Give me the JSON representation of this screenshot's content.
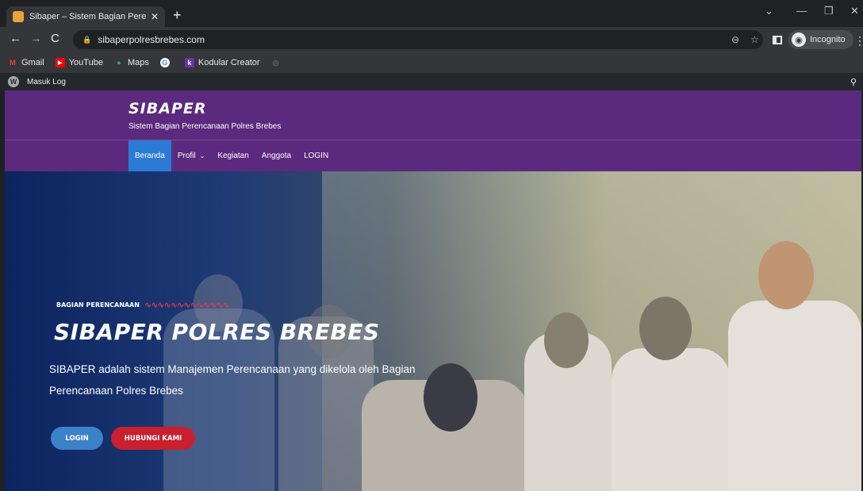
{
  "browser": {
    "tab_title": "Sibaper – Sistem Bagian Perencaa",
    "url": "sibaperpolresbrebes.com",
    "incognito_label": "Incognito",
    "bookmarks": [
      {
        "label": "Gmail",
        "icon": "gmail-icon",
        "color": "#ea4335"
      },
      {
        "label": "YouTube",
        "icon": "youtube-icon",
        "color": "#ff0000"
      },
      {
        "label": "Maps",
        "icon": "maps-icon",
        "color": "#34a853"
      },
      {
        "label": "",
        "icon": "google-icon",
        "color": "#ffffff"
      },
      {
        "label": "Kodular Creator",
        "icon": "kodular-icon",
        "color": "#6a32b0"
      }
    ]
  },
  "admin_bar": {
    "login_label": "Masuk Log"
  },
  "site": {
    "brand": "SIBAPER",
    "tagline": "Sistem Bagian Perencanaan Polres Brebes",
    "nav": [
      "Beranda",
      "Profil",
      "Kegiatan",
      "Anggota",
      "LOGIN"
    ],
    "accent": "#5b2a7e",
    "active_color": "#2b7bd5"
  },
  "hero": {
    "eyebrow": "BAGIAN PERENCANAAN",
    "title": "SIBAPER POLRES BREBES",
    "description": "SIBAPER adalah sistem Manajemen Perencanaan yang dikelola oleh Bagian Perencanaan Polres Brebes",
    "login_button": "LOGIN",
    "contact_button": "HUBUNGI KAMI"
  }
}
